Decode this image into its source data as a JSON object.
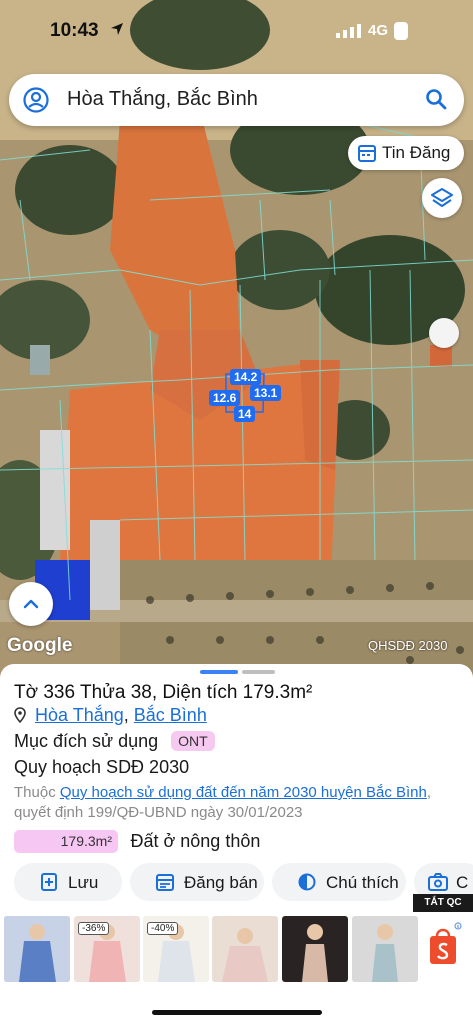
{
  "status": {
    "time": "10:43",
    "network": "4G"
  },
  "search": {
    "query": "Hòa Thắng, Bắc Bình"
  },
  "map": {
    "news_button_label": "Tin Đăng",
    "google_label": "Google",
    "layer_badge": "QHSDĐ 2030",
    "dimensions": [
      "14.2",
      "13.1",
      "12.6",
      "14"
    ]
  },
  "parcel": {
    "title": "Tờ 336 Thửa 38, Diện tích 179.3m²",
    "commune": "Hòa Thắng",
    "separator": ",",
    "district": "Bắc Bình",
    "purpose_label": "Mục đích sử dụng",
    "purpose_code": "ONT",
    "planning_label": "Quy hoạch SDĐ 2030",
    "planning_prefix": "Thuộc",
    "planning_link": "Quy hoạch sử dụng đất đến năm 2030 huyện Bắc Bình",
    "planning_suffix": ", quyết định 199/QĐ-UBND ngày 30/01/2023",
    "area_value": "179.3m²",
    "area_fraction": 1.0,
    "area_name": "Đất ở nông thôn"
  },
  "actions": [
    {
      "label": "Lưu",
      "icon": "bookmark-plus-icon"
    },
    {
      "label": "Đăng bán",
      "icon": "calendar-list-icon"
    },
    {
      "label": "Chú thích",
      "icon": "contrast-icon"
    },
    {
      "label": "C",
      "icon": "camera-plus-icon"
    }
  ],
  "ads": {
    "close_label": "TẮT QC",
    "discounts": [
      "-36%",
      "-40%"
    ]
  },
  "colors": {
    "accent": "#1a6fd8",
    "land_tag": "#f7c7f4",
    "soil": "#e0763f"
  }
}
